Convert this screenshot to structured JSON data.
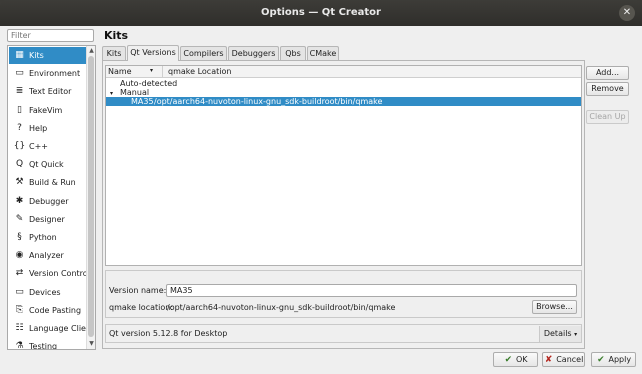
{
  "window": {
    "title": "Options — Qt Creator",
    "close_glyph": "✕"
  },
  "filter": {
    "placeholder": "Filter"
  },
  "sidebar": {
    "items": [
      {
        "label": "Kits",
        "icon": "kits-icon",
        "glyph": "▦",
        "selected": true
      },
      {
        "label": "Environment",
        "icon": "monitor-icon",
        "glyph": "▭"
      },
      {
        "label": "Text Editor",
        "icon": "text-editor-icon",
        "glyph": "≣"
      },
      {
        "label": "FakeVim",
        "icon": "fakevim-icon",
        "glyph": "▯"
      },
      {
        "label": "Help",
        "icon": "help-icon",
        "glyph": "?"
      },
      {
        "label": "C++",
        "icon": "braces-icon",
        "glyph": "{}"
      },
      {
        "label": "Qt Quick",
        "icon": "qt-quick-icon",
        "glyph": "Q"
      },
      {
        "label": "Build & Run",
        "icon": "hammer-icon",
        "glyph": "⚒"
      },
      {
        "label": "Debugger",
        "icon": "bug-icon",
        "glyph": "✱"
      },
      {
        "label": "Designer",
        "icon": "pencil-icon",
        "glyph": "✎"
      },
      {
        "label": "Python",
        "icon": "python-icon",
        "glyph": "§"
      },
      {
        "label": "Analyzer",
        "icon": "analyzer-icon",
        "glyph": "◉"
      },
      {
        "label": "Version Control",
        "icon": "version-control-icon",
        "glyph": "⇄"
      },
      {
        "label": "Devices",
        "icon": "device-icon",
        "glyph": "▭"
      },
      {
        "label": "Code Pasting",
        "icon": "clipboard-icon",
        "glyph": "⎘"
      },
      {
        "label": "Language Client",
        "icon": "language-client-icon",
        "glyph": "☷"
      },
      {
        "label": "Testing",
        "icon": "testing-icon",
        "glyph": "⚗"
      }
    ],
    "scroll_up": "▲",
    "scroll_down": "▼"
  },
  "main": {
    "section_title": "Kits",
    "tabs": [
      {
        "label": "Kits"
      },
      {
        "label": "Qt Versions",
        "active": true
      },
      {
        "label": "Compilers"
      },
      {
        "label": "Debuggers"
      },
      {
        "label": "Qbs"
      },
      {
        "label": "CMake"
      }
    ],
    "tree": {
      "columns": [
        "Name",
        "qmake Location"
      ],
      "sort_glyph": "▾",
      "rows": [
        {
          "text": "Auto-detected",
          "expander": "",
          "indent": 1
        },
        {
          "text": "Manual",
          "expander": "▾",
          "indent": 0
        },
        {
          "name": "MA35",
          "location": "/opt/aarch64-nuvoton-linux-gnu_sdk-buildroot/bin/qmake",
          "selected": true
        }
      ]
    },
    "buttons": {
      "add": "Add...",
      "remove": "Remove",
      "clean_up": "Clean Up"
    },
    "details": {
      "version_name_label": "Version name:",
      "version_name_value": "MA35",
      "qmake_location_label": "qmake location:",
      "qmake_location_value": "/opt/aarch64-nuvoton-linux-gnu_sdk-buildroot/bin/qmake",
      "browse": "Browse...",
      "qt_version_text": "Qt version 5.12.8 for Desktop",
      "details_label": "Details",
      "details_glyph": "▾"
    }
  },
  "dialog_buttons": {
    "ok": {
      "label": "OK",
      "glyph": "✔"
    },
    "cancel": {
      "label": "Cancel",
      "glyph": "✘"
    },
    "apply": {
      "label": "Apply",
      "glyph": "✔"
    }
  },
  "colors": {
    "selection": "#308cc6",
    "titlebar": "#3d3c38"
  }
}
